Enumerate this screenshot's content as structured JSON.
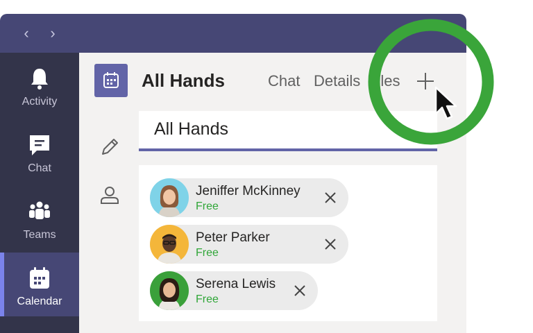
{
  "nav": {
    "back_icon": "chevron-left-icon",
    "forward_icon": "chevron-right-icon"
  },
  "rail": [
    {
      "label": "Activity",
      "icon": "bell-icon"
    },
    {
      "label": "Chat",
      "icon": "chat-icon"
    },
    {
      "label": "Teams",
      "icon": "teams-icon"
    },
    {
      "label": "Calendar",
      "icon": "calendar-icon",
      "active": true
    }
  ],
  "header": {
    "title": "All Hands",
    "tabs": [
      "Chat",
      "Details",
      "Files"
    ],
    "add_tab_icon": "plus-icon"
  },
  "form": {
    "title_value": "All Hands",
    "attendees": [
      {
        "name": "Jeniffer McKinney",
        "status": "Free"
      },
      {
        "name": "Peter Parker",
        "status": "Free"
      },
      {
        "name": "Serena Lewis",
        "status": "Free"
      }
    ]
  },
  "colors": {
    "accent": "#6264a7",
    "titlebar": "#464775",
    "rail": "#33344a",
    "free": "#30a638",
    "highlight_ring": "#3aa53a"
  }
}
